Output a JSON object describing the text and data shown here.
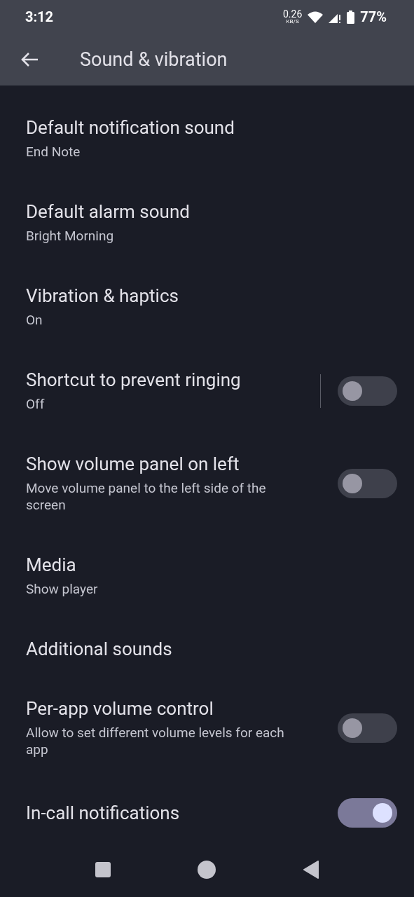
{
  "status_bar": {
    "time": "3:12",
    "speed": "0.26",
    "speed_unit": "KB/S",
    "battery": "77%"
  },
  "app_bar": {
    "title": "Sound & vibration"
  },
  "settings": [
    {
      "kind": "nav",
      "title": "Default notification sound",
      "summary": "End Note"
    },
    {
      "kind": "nav",
      "title": "Default alarm sound",
      "summary": "Bright Morning"
    },
    {
      "kind": "nav",
      "title": "Vibration & haptics",
      "summary": "On"
    },
    {
      "kind": "switch",
      "title": "Shortcut to prevent ringing",
      "summary": "Off",
      "on": false,
      "divider": true
    },
    {
      "kind": "switch",
      "title": "Show volume panel on left",
      "summary": "Move volume panel to the left side of the screen",
      "on": false,
      "divider": false
    },
    {
      "kind": "nav",
      "title": "Media",
      "summary": "Show player"
    },
    {
      "kind": "nav",
      "title": "Additional sounds"
    },
    {
      "kind": "switch",
      "title": "Per-app volume control",
      "summary": "Allow to set different volume levels for each app",
      "on": false,
      "divider": false
    },
    {
      "kind": "switch",
      "title": "In-call notifications",
      "on": true,
      "divider": false
    }
  ]
}
